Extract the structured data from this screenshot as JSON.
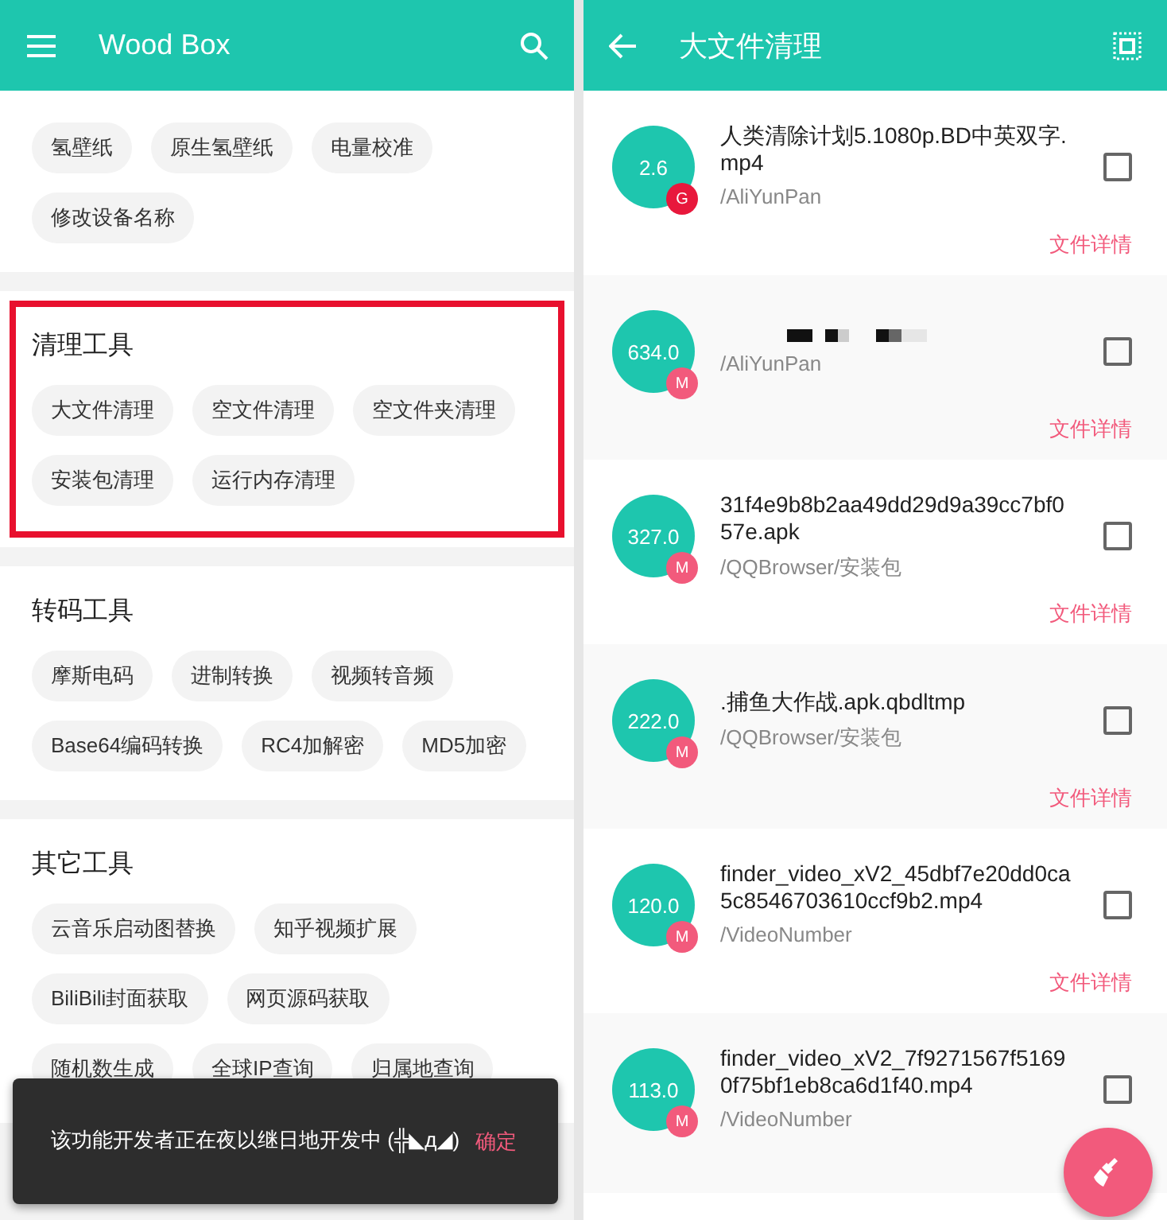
{
  "left_screen": {
    "app_bar": {
      "title": "Wood Box"
    },
    "sections": [
      {
        "highlighted": false,
        "chips": [
          "氢壁纸",
          "原生氢壁纸",
          "电量校准",
          "修改设备名称"
        ]
      },
      {
        "title": "清理工具",
        "highlighted": true,
        "chips": [
          "大文件清理",
          "空文件清理",
          "空文件夹清理",
          "安装包清理",
          "运行内存清理"
        ]
      },
      {
        "title": "转码工具",
        "highlighted": false,
        "chips": [
          "摩斯电码",
          "进制转换",
          "视频转音频",
          "Base64编码转换",
          "RC4加解密",
          "MD5加密"
        ]
      },
      {
        "title": "其它工具",
        "highlighted": false,
        "chips": [
          "云音乐启动图替换",
          "知乎视频扩展",
          "BiliBili封面获取",
          "网页源码获取",
          "随机数生成",
          "全球IP查询",
          "归属地查询"
        ]
      }
    ],
    "snackbar": {
      "message": "该功能开发者正在夜以继日地开发中 (╬◣д◢)",
      "action": "确定"
    }
  },
  "right_screen": {
    "app_bar": {
      "title": "大文件清理"
    },
    "files": [
      {
        "kind": "file",
        "size": "2.6",
        "unit": "G",
        "color": "#e8183c",
        "name": "人类清除计划5.1080p.BD中英双字.mp4",
        "path": "/AliYunPan",
        "checked": false,
        "details": "文件详情"
      },
      {
        "kind": "redacted",
        "size": "634.0",
        "unit": "M",
        "color": "#f25a7c",
        "path": "/AliYunPan",
        "checked": false,
        "details": "文件详情"
      },
      {
        "kind": "file",
        "size": "327.0",
        "unit": "M",
        "color": "#f25a7c",
        "name": "31f4e9b8b2aa49dd29d9a39cc7bf057e.apk",
        "path": "/QQBrowser/安装包",
        "checked": false,
        "details": "文件详情"
      },
      {
        "kind": "file",
        "size": "222.0",
        "unit": "M",
        "color": "#f25a7c",
        "name": ".捕鱼大作战.apk.qbdltmp",
        "path": "/QQBrowser/安装包",
        "checked": false,
        "details": "文件详情"
      },
      {
        "kind": "file",
        "size": "120.0",
        "unit": "M",
        "color": "#f25a7c",
        "name": "finder_video_xV2_45dbf7e20dd0ca5c8546703610ccf9b2.mp4",
        "path": "/VideoNumber",
        "checked": false,
        "details": "文件详情"
      },
      {
        "kind": "file",
        "size": "113.0",
        "unit": "M",
        "color": "#f25a7c",
        "name": "finder_video_xV2_7f9271567f51690f75bf1eb8ca6d1f40.mp4",
        "path": "/VideoNumber",
        "checked": false
      }
    ]
  }
}
